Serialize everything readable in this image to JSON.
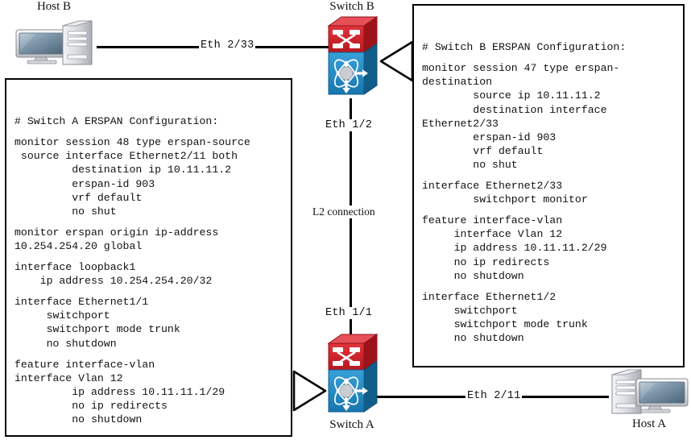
{
  "diagram": {
    "title": "ERSPAN source/destination topology",
    "colors": {
      "wire": "#000000",
      "switch_top": "#cc2229",
      "switch_bottom": "#2288c4",
      "switch_top_dark": "#8f1419",
      "switch_bottom_dark": "#176391",
      "host_body": "#d8dade",
      "host_screen": "#7f97ab",
      "box_border": "#000000",
      "text": "#111111"
    }
  },
  "nodes": {
    "host_b": {
      "label": "Host B",
      "icon": "desktop-computer-icon"
    },
    "host_a": {
      "label": "Host A",
      "icon": "desktop-computer-icon"
    },
    "switch_b": {
      "label": "Switch B",
      "icon": "multilayer-switch-icon"
    },
    "switch_a": {
      "label": "Switch A",
      "icon": "multilayer-switch-icon"
    }
  },
  "links": [
    {
      "id": "host-b-to-switch-b",
      "label": "Eth 2/33",
      "from": "host_b",
      "to": "switch_b"
    },
    {
      "id": "switch-b-to-switch-a",
      "label": "Eth 1/2",
      "from": "switch_b",
      "to": "switch_a"
    },
    {
      "id": "switch-a-to-switch-b",
      "label": "Eth 1/1",
      "from": "switch_a",
      "to": "switch_b"
    },
    {
      "id": "switch-a-to-host-a",
      "label": "Eth 2/11",
      "from": "switch_a",
      "to": "host_a"
    }
  ],
  "annotations": {
    "l2_connection": "L2 connection"
  },
  "config_switch_a": {
    "title": "Switch A ERSPAN configuration box",
    "lines": [
      "# Switch A ERSPAN Configuration:",
      "",
      "monitor session 48 type erspan-source",
      " source interface Ethernet2/11 both",
      "         destination ip 10.11.11.2",
      "         erspan-id 903",
      "         vrf default",
      "         no shut",
      "",
      "monitor erspan origin ip-address",
      "10.254.254.20 global",
      "",
      "interface loopback1",
      "    ip address 10.254.254.20/32",
      "",
      "interface Ethernet1/1",
      "     switchport",
      "     switchport mode trunk",
      "     no shutdown",
      "",
      "feature interface-vlan",
      "interface Vlan 12",
      "         ip address 10.11.11.1/29",
      "         no ip redirects",
      "         no shutdown"
    ]
  },
  "config_switch_b": {
    "title": "Switch B ERSPAN configuration box",
    "lines": [
      "# Switch B ERSPAN Configuration:",
      "",
      "monitor session 47 type erspan-",
      "destination",
      "        source ip 10.11.11.2",
      "        destination interface",
      "Ethernet2/33",
      "        erspan-id 903",
      "        vrf default",
      "        no shut",
      "",
      "interface Ethernet2/33",
      "        switchport monitor",
      "",
      "feature interface-vlan",
      "     interface Vlan 12",
      "     ip address 10.11.11.2/29",
      "     no ip redirects",
      "     no shutdown",
      "",
      "interface Ethernet1/2",
      "     switchport",
      "     switchport mode trunk",
      "     no shutdown"
    ]
  }
}
